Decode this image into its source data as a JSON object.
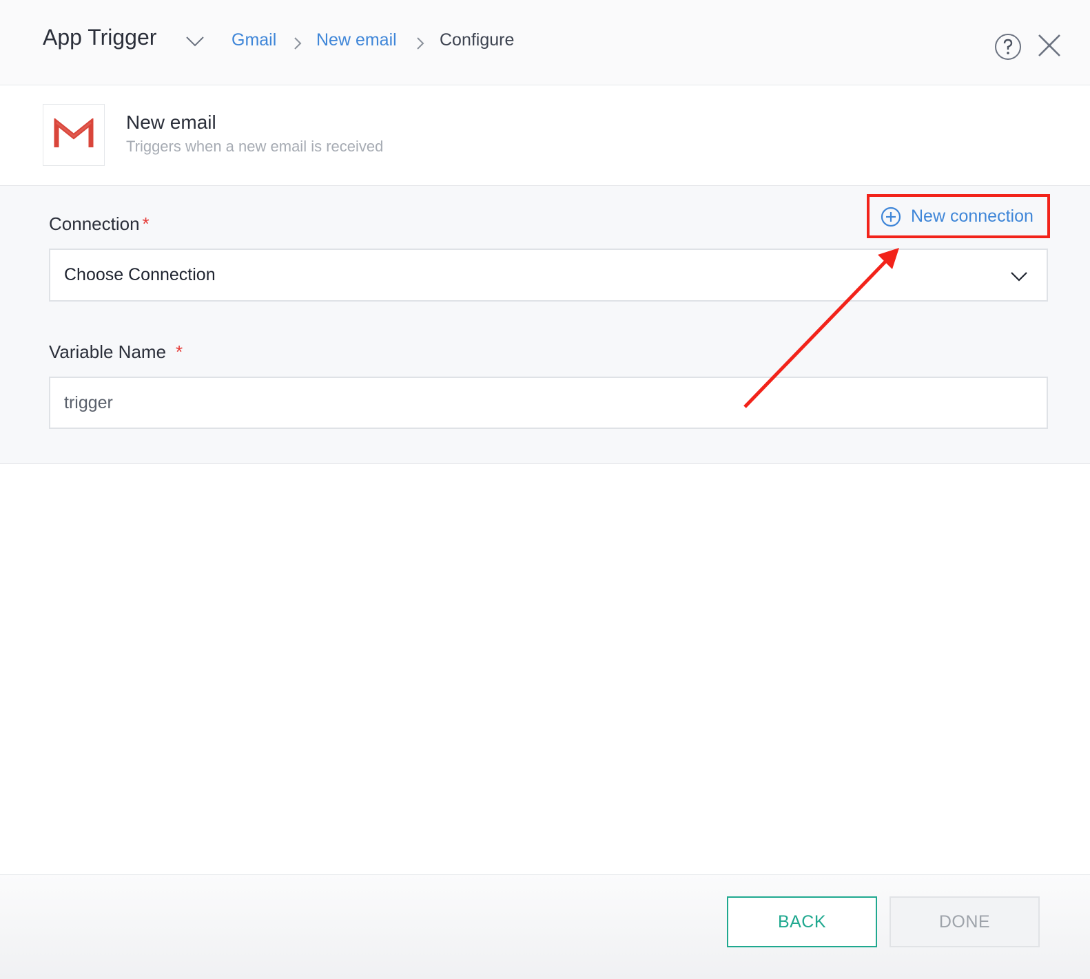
{
  "header": {
    "title": "App Trigger",
    "breadcrumb": [
      {
        "label": "Gmail",
        "link": true
      },
      {
        "label": "New email",
        "link": true
      },
      {
        "label": "Configure",
        "link": false
      }
    ],
    "icons": [
      "chevron-down-icon",
      "chevron-right-icon",
      "help-icon",
      "close-icon"
    ]
  },
  "trigger": {
    "app_icon": "gmail-logo",
    "name": "New email",
    "description": "Triggers when a new email is received"
  },
  "form": {
    "connection": {
      "label": "Connection",
      "required_mark": "*",
      "selected": "Choose Connection",
      "new_connection_label": "New connection"
    },
    "variable_name": {
      "label": "Variable Name",
      "required_mark": "*",
      "value": "trigger"
    }
  },
  "footer": {
    "back_label": "BACK",
    "done_label": "DONE"
  },
  "colors": {
    "accent_blue": "#3f86d8",
    "accent_green": "#1fa88f",
    "annotation_red": "#f2231a",
    "required_red": "#e53935"
  }
}
